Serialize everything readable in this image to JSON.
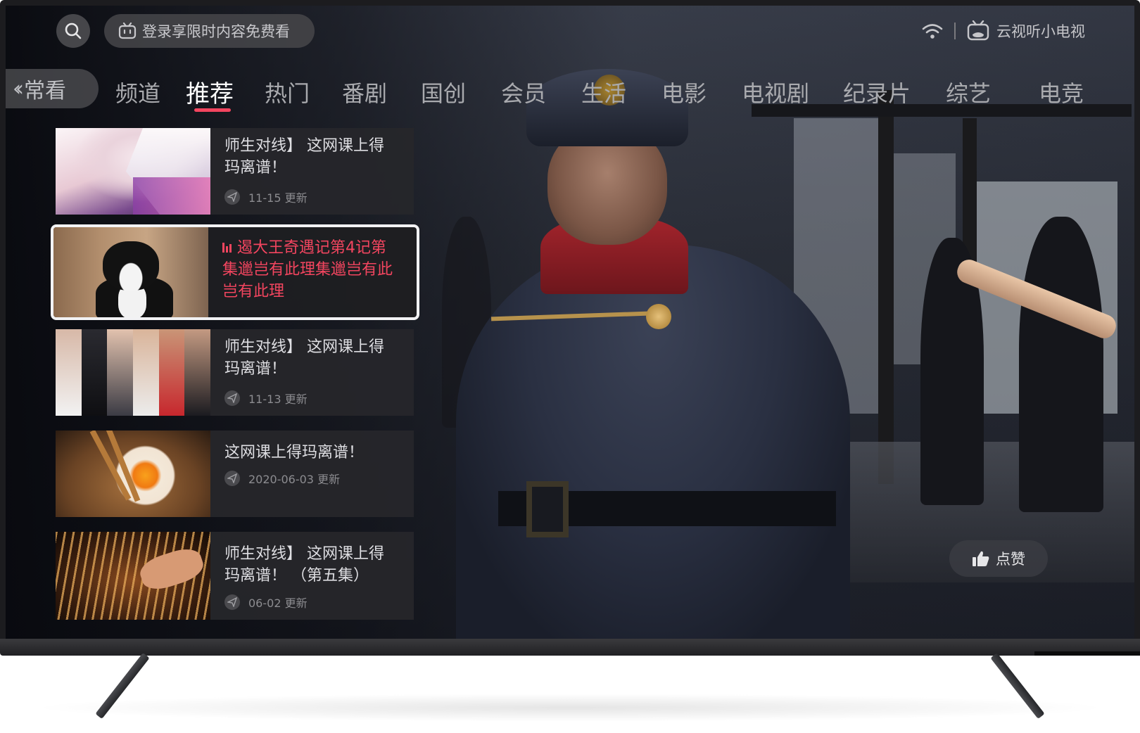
{
  "topbar": {
    "login_prompt": "登录享限时内容免费看",
    "brand_name": "云视听小电视"
  },
  "nav": {
    "back_label": "常看",
    "tabs": [
      {
        "label": "频道",
        "active": false
      },
      {
        "label": "推荐",
        "active": true
      },
      {
        "label": "热门",
        "active": false
      },
      {
        "label": "番剧",
        "active": false
      },
      {
        "label": "国创",
        "active": false
      },
      {
        "label": "会员",
        "active": false
      },
      {
        "label": "生活",
        "active": false
      },
      {
        "label": "电影",
        "active": false
      },
      {
        "label": "电视剧",
        "active": false
      },
      {
        "label": "纪录片",
        "active": false
      },
      {
        "label": "综艺",
        "active": false
      },
      {
        "label": "电竞",
        "active": false
      }
    ]
  },
  "cards": [
    {
      "title_line1": "师生对线】 这网课上得",
      "title_line2": "玛离谱！",
      "meta": "11-15 更新",
      "thumb": "anime-illustration"
    },
    {
      "title_line1": "遏大王奇遇记第4记第",
      "title_line2": "集邋岂有此理集邋岂有此",
      "title_line3": "岂有此理",
      "focused": true,
      "playing": true,
      "thumb": "black-white-cat"
    },
    {
      "title_line1": "师生对线】 这网课上得",
      "title_line2": "玛离谱！",
      "meta": "11-13 更新",
      "thumb": "cast-portraits"
    },
    {
      "title_line1": "这网课上得玛离谱！",
      "meta": "2020-06-03 更新",
      "thumb": "food-dish"
    },
    {
      "title_line1": "师生对线】 这网课上得",
      "title_line2": "玛离谱！ （第五集）",
      "meta": "06-02 更新",
      "thumb": "grill-skewers"
    }
  ],
  "like_button": {
    "label": "点赞"
  },
  "colors": {
    "accent": "#f3455f",
    "card_bg": "#26262a",
    "text_primary": "#dedee2",
    "text_secondary": "#8c8c90"
  },
  "icons": [
    "search-icon",
    "tv-icon",
    "wifi-icon",
    "bilibili-tv-icon",
    "chevron-left-icon",
    "send-icon",
    "playing-bars-icon",
    "thumbs-up-icon"
  ]
}
